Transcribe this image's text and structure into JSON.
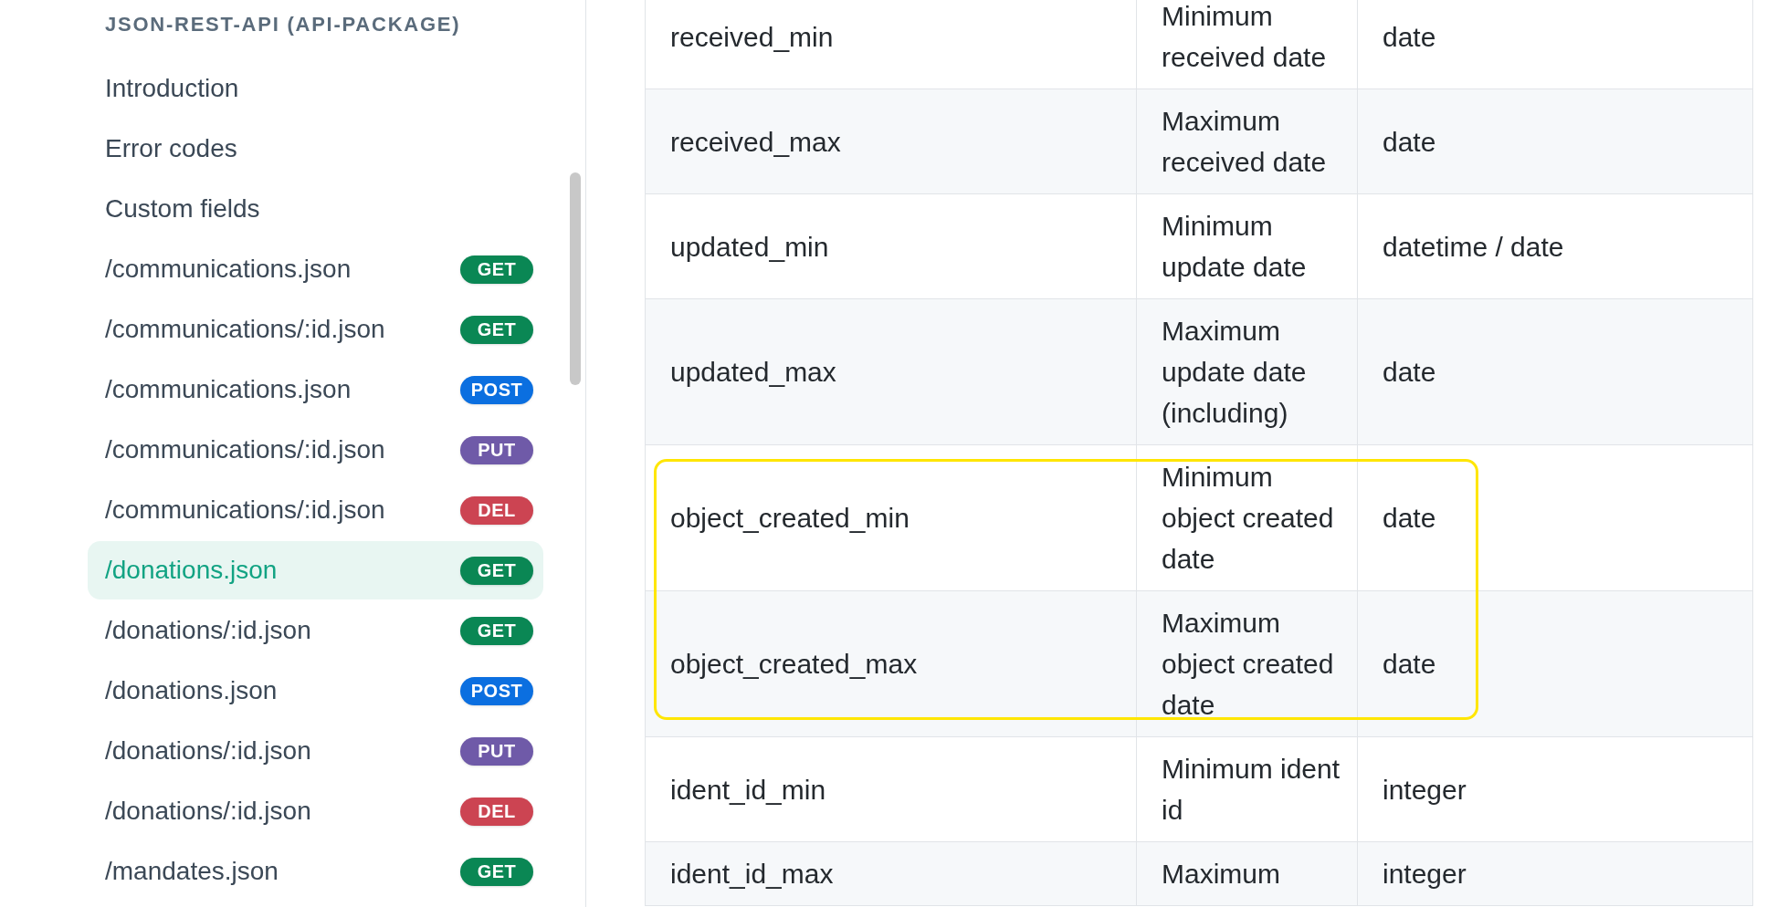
{
  "sidebar": {
    "heading": "JSON-REST-API (API-PACKAGE)",
    "items": [
      {
        "label": "Introduction",
        "selected": false
      },
      {
        "label": "Error codes",
        "selected": false
      },
      {
        "label": "Custom fields",
        "selected": false
      },
      {
        "label": "/communications.json",
        "method": "GET",
        "selected": false
      },
      {
        "label": "/communications/:id.json",
        "method": "GET",
        "selected": false
      },
      {
        "label": "/communications.json",
        "method": "POST",
        "selected": false
      },
      {
        "label": "/communications/:id.json",
        "method": "PUT",
        "selected": false
      },
      {
        "label": "/communications/:id.json",
        "method": "DEL",
        "selected": false
      },
      {
        "label": "/donations.json",
        "method": "GET",
        "selected": true
      },
      {
        "label": "/donations/:id.json",
        "method": "GET",
        "selected": false
      },
      {
        "label": "/donations.json",
        "method": "POST",
        "selected": false
      },
      {
        "label": "/donations/:id.json",
        "method": "PUT",
        "selected": false
      },
      {
        "label": "/donations/:id.json",
        "method": "DEL",
        "selected": false
      },
      {
        "label": "/mandates.json",
        "method": "GET",
        "selected": false
      }
    ]
  },
  "table": {
    "rows": [
      {
        "name": "received_min",
        "description": "Minimum received date",
        "type": "date",
        "highlighted": false
      },
      {
        "name": "received_max",
        "description": "Maximum received date",
        "type": "date",
        "highlighted": false
      },
      {
        "name": "updated_min",
        "description": "Minimum update date",
        "type": "datetime / date",
        "highlighted": false
      },
      {
        "name": "updated_max",
        "description": "Maximum update date (including)",
        "type": "date",
        "highlighted": false
      },
      {
        "name": "object_created_min",
        "description": "Minimum object created date",
        "type": "date",
        "highlighted": true
      },
      {
        "name": "object_created_max",
        "description": "Maximum object created date",
        "type": "date",
        "highlighted": true
      },
      {
        "name": "ident_id_min",
        "description": "Minimum ident id",
        "type": "integer",
        "highlighted": false
      },
      {
        "name": "ident_id_max",
        "description": "Maximum",
        "type": "integer",
        "highlighted": false
      }
    ]
  }
}
